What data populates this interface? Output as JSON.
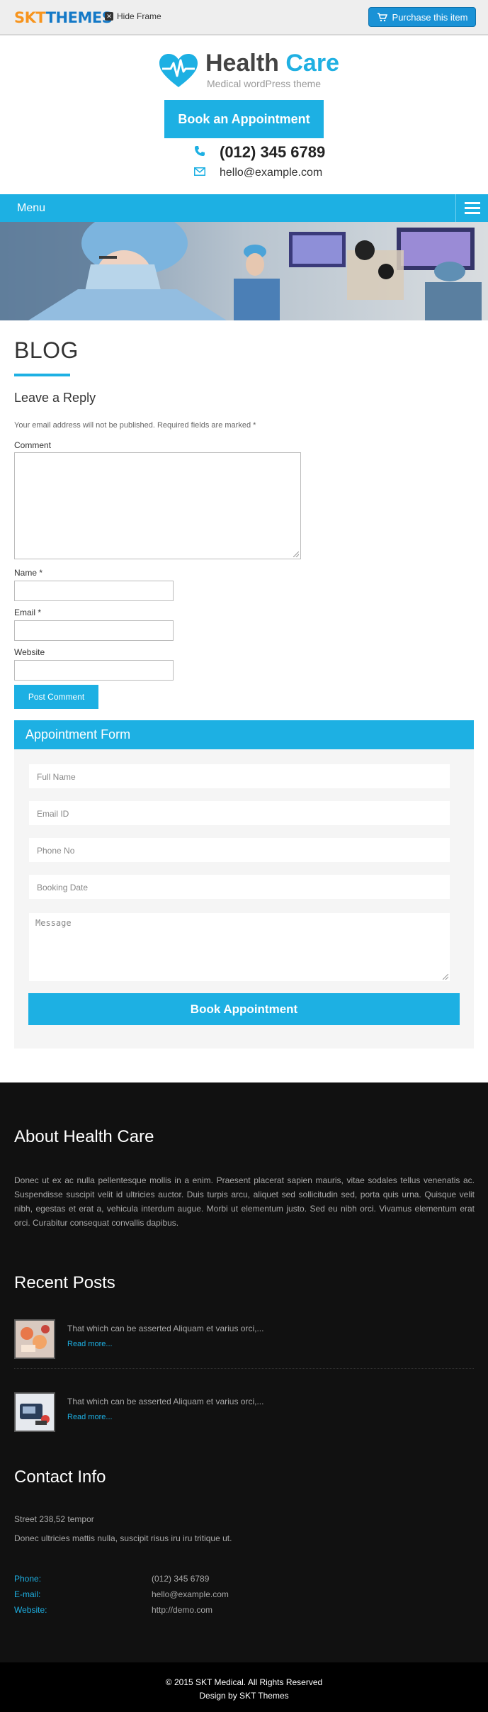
{
  "framebar": {
    "logo_skt": "SKT",
    "logo_themes": "THEMES",
    "hide_frame": "Hide Frame",
    "purchase": "Purchase this item"
  },
  "header": {
    "brand_main": "Health",
    "brand_accent": "Care",
    "tagline": "Medical wordPress theme",
    "book_button": "Book an Appointment",
    "phone": "(012) 345 6789",
    "email": "hello@example.com"
  },
  "nav": {
    "menu_label": "Menu"
  },
  "content": {
    "page_title": "BLOG",
    "reply_title": "Leave a Reply",
    "notes": "Your email address will not be published. Required fields are marked *",
    "comment_label": "Comment",
    "name_label": "Name *",
    "email_label": "Email *",
    "website_label": "Website",
    "post_button": "Post Comment"
  },
  "appointment": {
    "title": "Appointment Form",
    "full_name_placeholder": "Full Name",
    "email_placeholder": "Email ID",
    "phone_placeholder": "Phone No",
    "date_placeholder": "Booking Date",
    "message_placeholder": "Message",
    "submit": "Book Appointment"
  },
  "footer": {
    "about_title": "About Health Care",
    "about_text": "Donec ut ex ac nulla pellentesque mollis in a enim. Praesent placerat sapien mauris, vitae sodales tellus venenatis ac. Suspendisse suscipit velit id ultricies auctor. Duis turpis arcu, aliquet sed sollicitudin sed, porta quis urna. Quisque velit nibh, egestas et erat a, vehicula interdum augue. Morbi ut elementum justo. Sed eu nibh orci. Vivamus elementum erat orci. Curabitur consequat convallis dapibus.",
    "recent_title": "Recent Posts",
    "posts": [
      {
        "title": "That which can be asserted Aliquam et varius orci,...",
        "more": "Read more..."
      },
      {
        "title": "That which can be asserted Aliquam et varius orci,...",
        "more": "Read more..."
      }
    ],
    "contact_title": "Contact Info",
    "address": "Street 238,52 tempor",
    "contact_text": "Donec ultricies mattis nulla, suscipit risus iru iru tritique ut.",
    "phone_key": "Phone:",
    "phone_val": "(012) 345 6789",
    "email_key": "E-mail:",
    "email_val": "hello@example.com",
    "website_key": "Website:",
    "website_val": "http://demo.com",
    "copyright": "© 2015 SKT Medical. All Rights Reserved",
    "design_by": "Design by SKT Themes"
  },
  "colors": {
    "accent": "#1db0e3",
    "footer_bg": "#111111",
    "bottom_bg": "#000000"
  }
}
